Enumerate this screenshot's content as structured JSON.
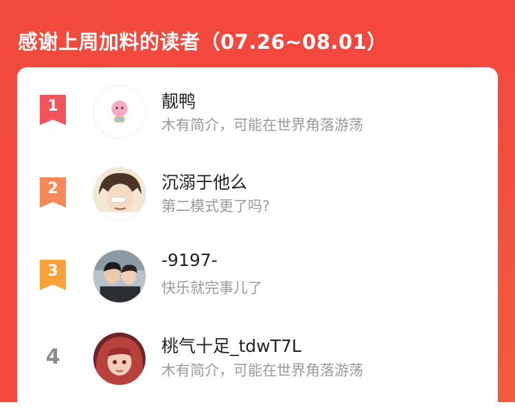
{
  "header": {
    "title": "感谢上周加料的读者（07.26~08.01）"
  },
  "colors": {
    "background": "#f4473e",
    "rank1": "#f2545b",
    "rank2": "#f7885a",
    "rank3": "#f7a23a",
    "rank_plain": "#8c8c8c",
    "name": "#222222",
    "bio": "#9a9a9a"
  },
  "readers": [
    {
      "rank": "1",
      "name": "靓鸭",
      "bio": "木有简介，可能在世界角落游荡",
      "avatar": "cartoon-pink-avatar"
    },
    {
      "rank": "2",
      "name": "沉溺于他么",
      "bio": "第二模式更了吗?",
      "avatar": "anime-boy-avatar"
    },
    {
      "rank": "3",
      "name": "-9197-",
      "bio": "快乐就完事儿了",
      "avatar": "photo-two-people-avatar"
    },
    {
      "rank": "4",
      "name": "桃气十足_tdwT7L",
      "bio": "木有简介，可能在世界角落游荡",
      "avatar": "anime-red-hair-avatar"
    }
  ]
}
